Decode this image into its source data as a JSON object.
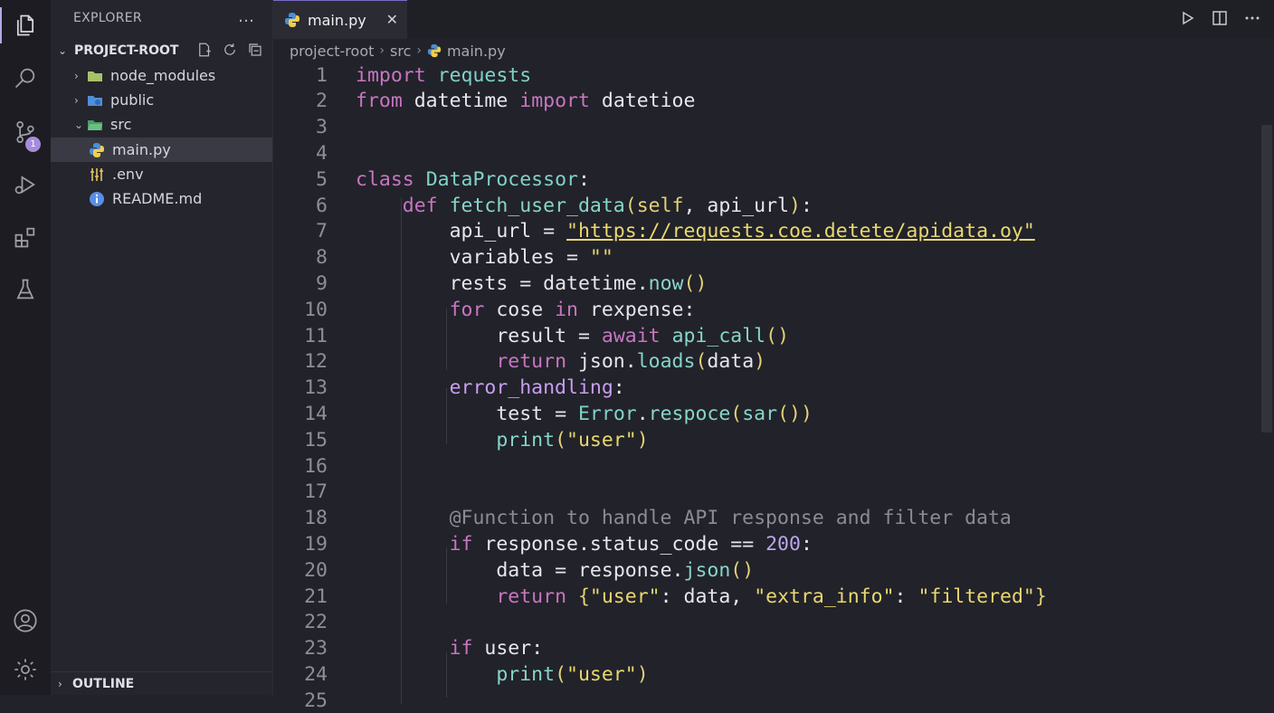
{
  "sidebar": {
    "title": "EXPLORER",
    "more": "…",
    "project": "PROJECT-ROOT",
    "items": [
      {
        "label": "node_modules"
      },
      {
        "label": "public"
      },
      {
        "label": "src"
      },
      {
        "label": "main.py"
      },
      {
        "label": ".env"
      },
      {
        "label": "README.md"
      }
    ],
    "outline": "OUTLINE"
  },
  "activity": {
    "badge": "1"
  },
  "tab": {
    "label": "main.py",
    "close": "✕"
  },
  "breadcrumb": {
    "parts": [
      "project-root",
      "src",
      "main.py"
    ]
  },
  "editor": {
    "line_numbers": [
      "1",
      "2",
      "3",
      "4",
      "5",
      "6",
      "7",
      "8",
      "9",
      "10",
      "11",
      "12",
      "13",
      "14",
      "15",
      "16",
      "17",
      "18",
      "19",
      "20",
      "21",
      "22",
      "23",
      "24",
      "25"
    ],
    "lines": [
      "import requests",
      "from datetime import datetioe",
      "",
      "",
      "class DataProcessor:",
      "    def fetch_user_data(self, api_url):",
      "        api_url = \"https://requests.coe.detete/apidata.oy\"",
      "        variables = \"\"",
      "        rests = datetime.now()",
      "        for cose in rexpense:",
      "            result = await api_call()",
      "            return json.loads(data)",
      "        error_handling:",
      "            test = Error.respoce(sar())",
      "            print(\"user\")",
      "",
      "",
      "        @Function to handle API response and filter data",
      "        if response.status_code == 200:",
      "            data = response.json()",
      "            return {\"user\": data, \"extra_info\": \"filtered\"}",
      "",
      "        if user:",
      "            print(\"user\")",
      ""
    ]
  }
}
